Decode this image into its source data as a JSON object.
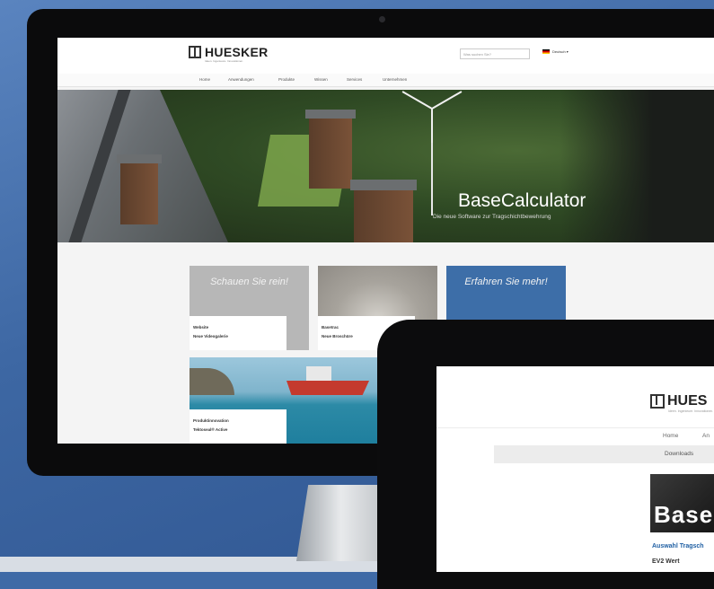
{
  "site": {
    "logo": "HUESKER",
    "tagline": "Ideen. Ingenieure. Innovationen.",
    "search_placeholder": "Was suchen Sie?",
    "language": "Deutsch ▾",
    "nav": [
      "Home",
      "Anwendungen",
      "Produkte",
      "Wissen",
      "Services",
      "Unternehmen"
    ]
  },
  "hero": {
    "title": "BaseCalculator",
    "subtitle": "Die neue Software zur Tragschichtbewehrung"
  },
  "tiles": [
    {
      "headline": "Schauen Sie rein!",
      "category": "Website",
      "title": "Neue Videogalerie"
    },
    {
      "headline": "",
      "category": "Basetrac",
      "title": "Neue Broschüre"
    },
    {
      "headline": "Erfahren Sie mehr!",
      "category": "",
      "title": ""
    },
    {
      "headline": "",
      "category": "Produktinnovation",
      "title": "Tektoseal® Active"
    }
  ],
  "ipad": {
    "logo": "HUES",
    "nav": [
      "Home",
      "An"
    ],
    "subnav": "Downloads",
    "banner": "Base",
    "link": "Auswahl Tragsch",
    "value_label": "EV2 Wert"
  },
  "colors": {
    "background": "#3f6aa6",
    "tile_blue": "#3d6ea8",
    "link_blue": "#1f5fa3"
  }
}
